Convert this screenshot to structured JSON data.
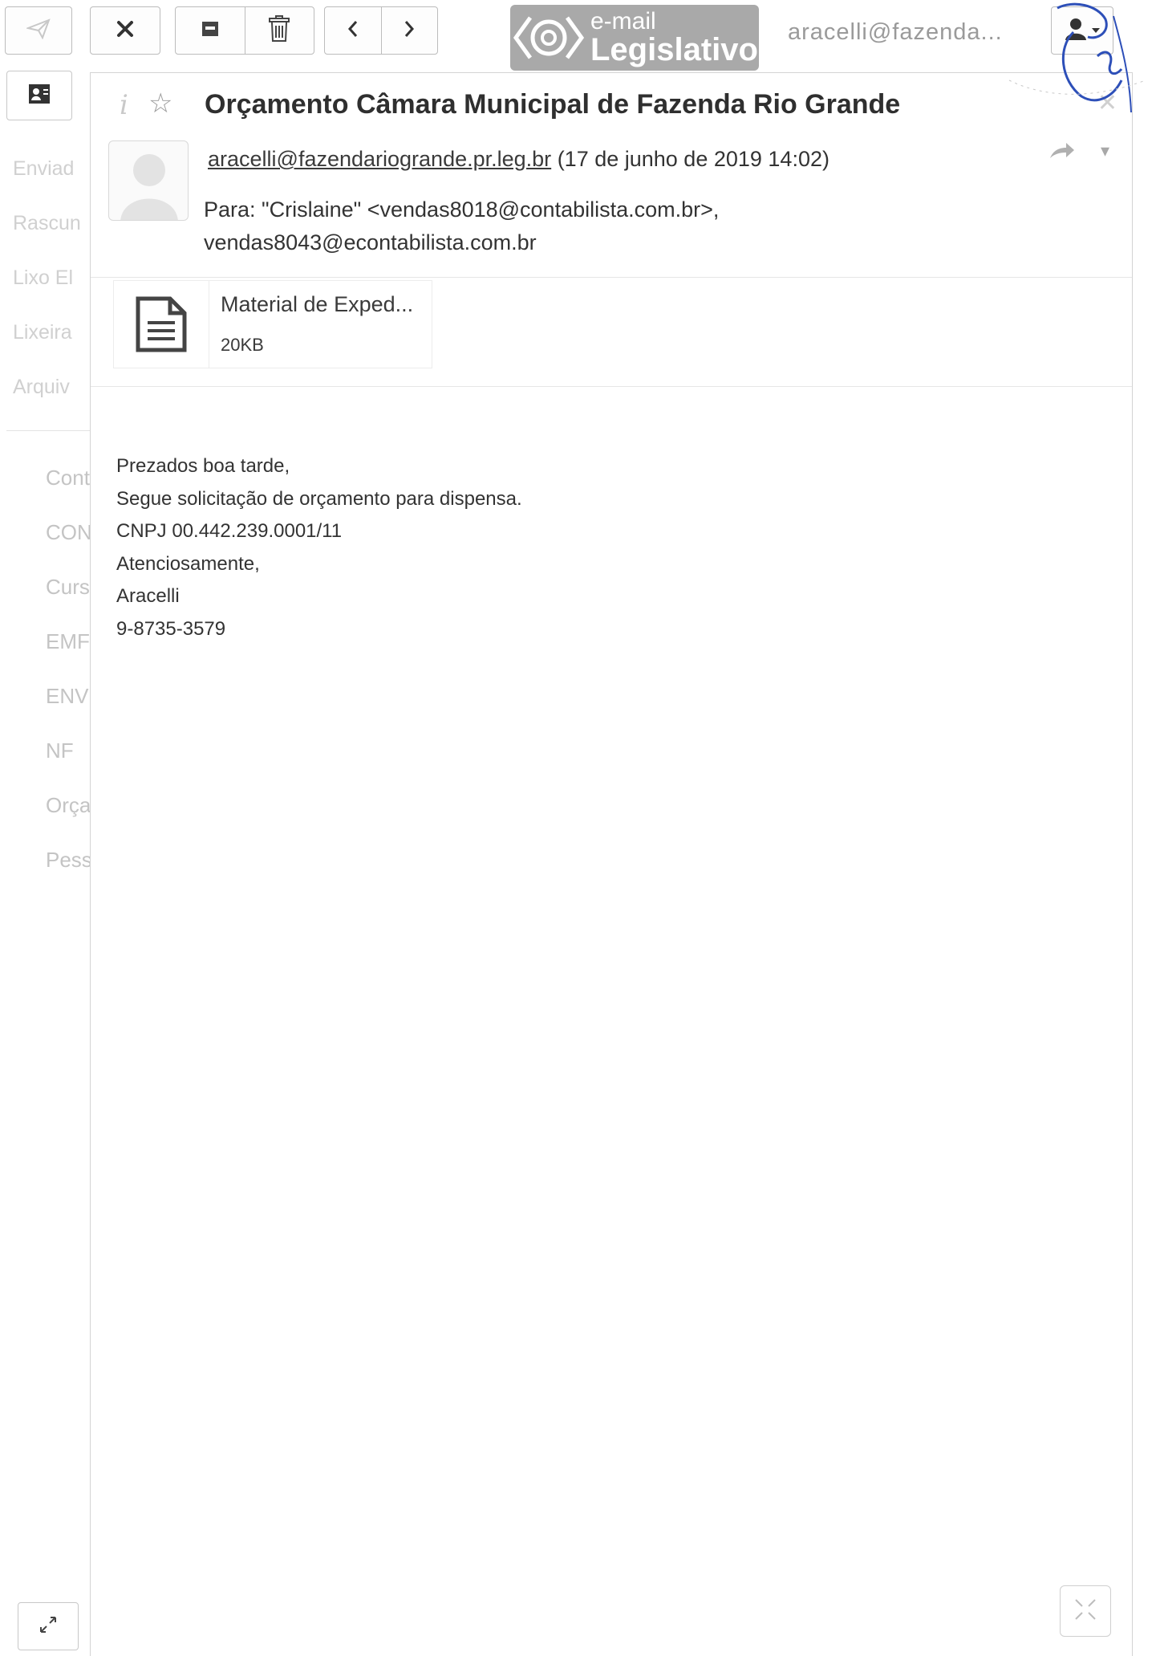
{
  "toolbar": {
    "icons": [
      "send-icon",
      "close-icon",
      "archive-icon",
      "trash-icon",
      "chevron-left-icon",
      "chevron-right-icon",
      "user-icon",
      "chevron-down-icon"
    ],
    "logo": {
      "line1": "e-mail",
      "line2": "Legislativo"
    },
    "user_email": "aracelli@fazenda..."
  },
  "sidebar": {
    "top_items": [
      {
        "label": "Enviad"
      },
      {
        "label": "Rascun"
      },
      {
        "label": "Lixo El"
      },
      {
        "label": "Lixeira"
      },
      {
        "label": "Arquiv"
      }
    ],
    "folders": [
      {
        "label": "Cont"
      },
      {
        "label": "CON"
      },
      {
        "label": "Curs"
      },
      {
        "label": "EMF"
      },
      {
        "label": "ENV"
      },
      {
        "label": "NF"
      },
      {
        "label": "Orça"
      },
      {
        "label": "Pess"
      }
    ]
  },
  "message": {
    "subject": "Orçamento Câmara Municipal de Fazenda Rio Grande",
    "from_address": "aracelli@fazendariogrande.pr.leg.br",
    "date": "(17 de junho de 2019 14:02)",
    "to_line1": "Para: \"Crislaine\" <vendas8018@contabilista.com.br>,",
    "to_line2": "vendas8043@econtabilista.com.br",
    "attachment": {
      "name": "Material de Exped...",
      "size": "20KB"
    },
    "body": [
      "Prezados boa tarde,",
      "Segue solicitação de orçamento para dispensa.",
      "CNPJ 00.442.239.0001/11",
      "Atenciosamente,",
      "Aracelli",
      "9-8735-3579"
    ]
  },
  "colors": {
    "logo_bg": "#a9a9a9",
    "stamp_ink": "#2d4fb8"
  }
}
